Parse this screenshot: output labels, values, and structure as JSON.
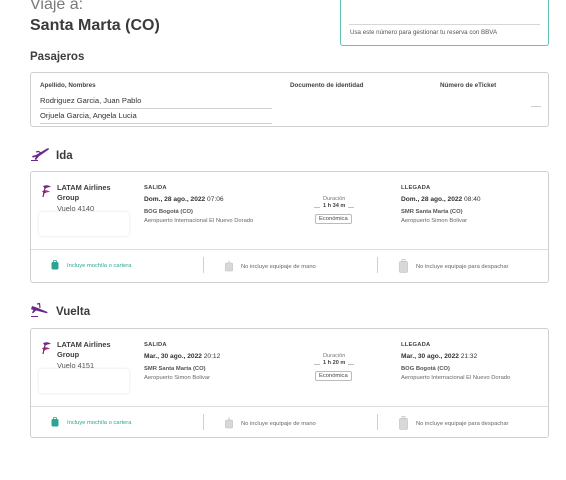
{
  "header": {
    "trip_prefix": "Viaje a:",
    "destination": "Santa Marta (CO)",
    "booking_note": "Usa este número para gestionar tu reserva con BBVA"
  },
  "passengers": {
    "title": "Pasajeros",
    "col_name": "Apellido, Nombres",
    "col_document": "Documento de identidad",
    "col_eticket": "Número de eTicket",
    "list": [
      "Rodriguez Garcia, Juan Pablo",
      "Orjuela Garcia, Angela Lucia"
    ]
  },
  "outbound": {
    "title": "Ida",
    "airline": "LATAM Airlines Group",
    "flight": "Vuelo 4140",
    "departure": {
      "heading": "SALIDA",
      "date": "Dom., 28 ago., 2022",
      "time": "07:06",
      "airport": "BOG Bogotá (CO)",
      "airport_name": "Aeropuerto Internacional El Nuevo Dorado"
    },
    "duration_label": "Duración",
    "duration": "1 h 34 m",
    "cabin": "Económica",
    "arrival": {
      "heading": "LLEGADA",
      "date": "Dom., 28 ago., 2022",
      "time": "08:40",
      "airport": "SMR Santa Marta (CO)",
      "airport_name": "Aeropuerto Simon Bolivar"
    },
    "baggage": {
      "carry_item": "Incluye mochila o cartera",
      "hand": "No incluye equipaje de mano",
      "checked": "No incluye equipaje para despachar"
    }
  },
  "return": {
    "title": "Vuelta",
    "airline": "LATAM Airlines Group",
    "flight": "Vuelo 4151",
    "departure": {
      "heading": "SALIDA",
      "date": "Mar., 30 ago., 2022",
      "time": "20:12",
      "airport": "SMR Santa Marta (CO)",
      "airport_name": "Aeropuerto Simon Bolivar"
    },
    "duration_label": "Duración",
    "duration": "1 h 20 m",
    "cabin": "Económica",
    "arrival": {
      "heading": "LLEGADA",
      "date": "Mar., 30 ago., 2022",
      "time": "21:32",
      "airport": "BOG Bogotá (CO)",
      "airport_name": "Aeropuerto Internacional El Nuevo Dorado"
    },
    "baggage": {
      "carry_item": "Incluye mochila o cartera",
      "hand": "No incluye equipaje de mano",
      "checked": "No incluye equipaje para despachar"
    }
  },
  "colors": {
    "accent": "#2aa593",
    "brand_purple": "#6b2a86",
    "border": "#cfcfcf"
  },
  "icons": {
    "outbound": "plane-takeoff-icon",
    "return": "plane-landing-icon",
    "airline": "latam-logo-icon",
    "carry_item": "backpack-icon",
    "hand": "hand-luggage-icon",
    "checked": "suitcase-icon"
  }
}
